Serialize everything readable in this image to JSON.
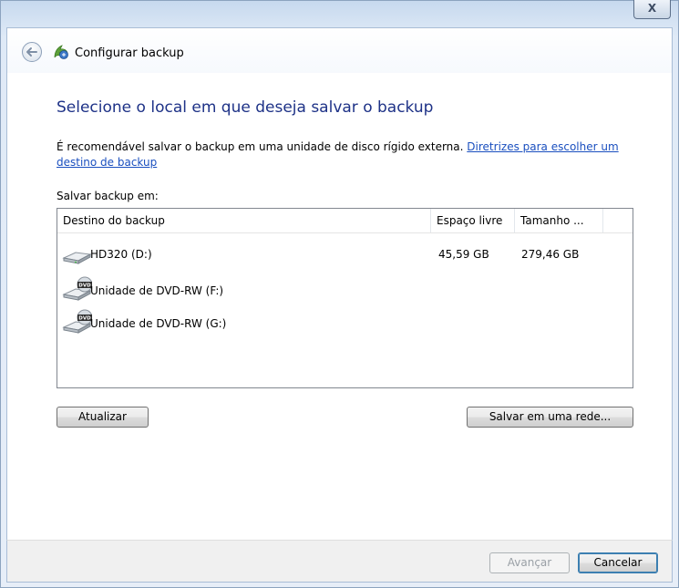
{
  "window": {
    "close_label": "X",
    "title": "Configurar backup"
  },
  "main": {
    "heading": "Selecione o local em que deseja salvar o backup",
    "description": "É recomendável salvar o backup em uma unidade de disco rígido externa.",
    "link_text": "Diretrizes para escolher um destino de backup",
    "save_label": "Salvar backup em:"
  },
  "table": {
    "columns": [
      "Destino do backup",
      "Espaço livre",
      "Tamanho ..."
    ],
    "rows": [
      {
        "icon": "hard-drive-icon",
        "name": "HD320 (D:)",
        "free": "45,59 GB",
        "size": "279,46 GB"
      },
      {
        "icon": "dvd-drive-icon",
        "name": "Unidade de DVD-RW (F:)",
        "free": "",
        "size": ""
      },
      {
        "icon": "dvd-drive-icon",
        "name": "Unidade de DVD-RW (G:)",
        "free": "",
        "size": ""
      }
    ]
  },
  "buttons": {
    "refresh": "Atualizar",
    "save_network": "Salvar em uma rede...",
    "next": "Avançar",
    "cancel": "Cancelar"
  }
}
